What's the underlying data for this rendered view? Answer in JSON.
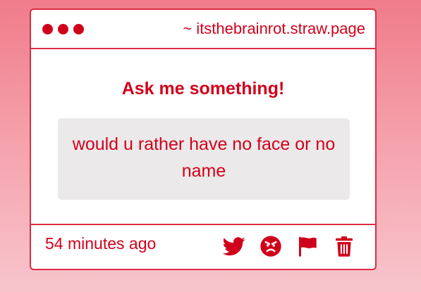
{
  "window": {
    "url": "~ itsthebrainrot.straw.page"
  },
  "main": {
    "heading": "Ask me something!",
    "question": "would u rather have no face or no name"
  },
  "footer": {
    "timestamp": "54 minutes ago",
    "actions": [
      "twitter-icon",
      "angry-face-icon",
      "flag-icon",
      "trash-icon"
    ]
  },
  "colors": {
    "accent": "#d0021b",
    "border": "#db2d43",
    "question_bg": "#ebe9ea",
    "background_top": "#f07c89",
    "background_bottom": "#f8c5cc"
  }
}
